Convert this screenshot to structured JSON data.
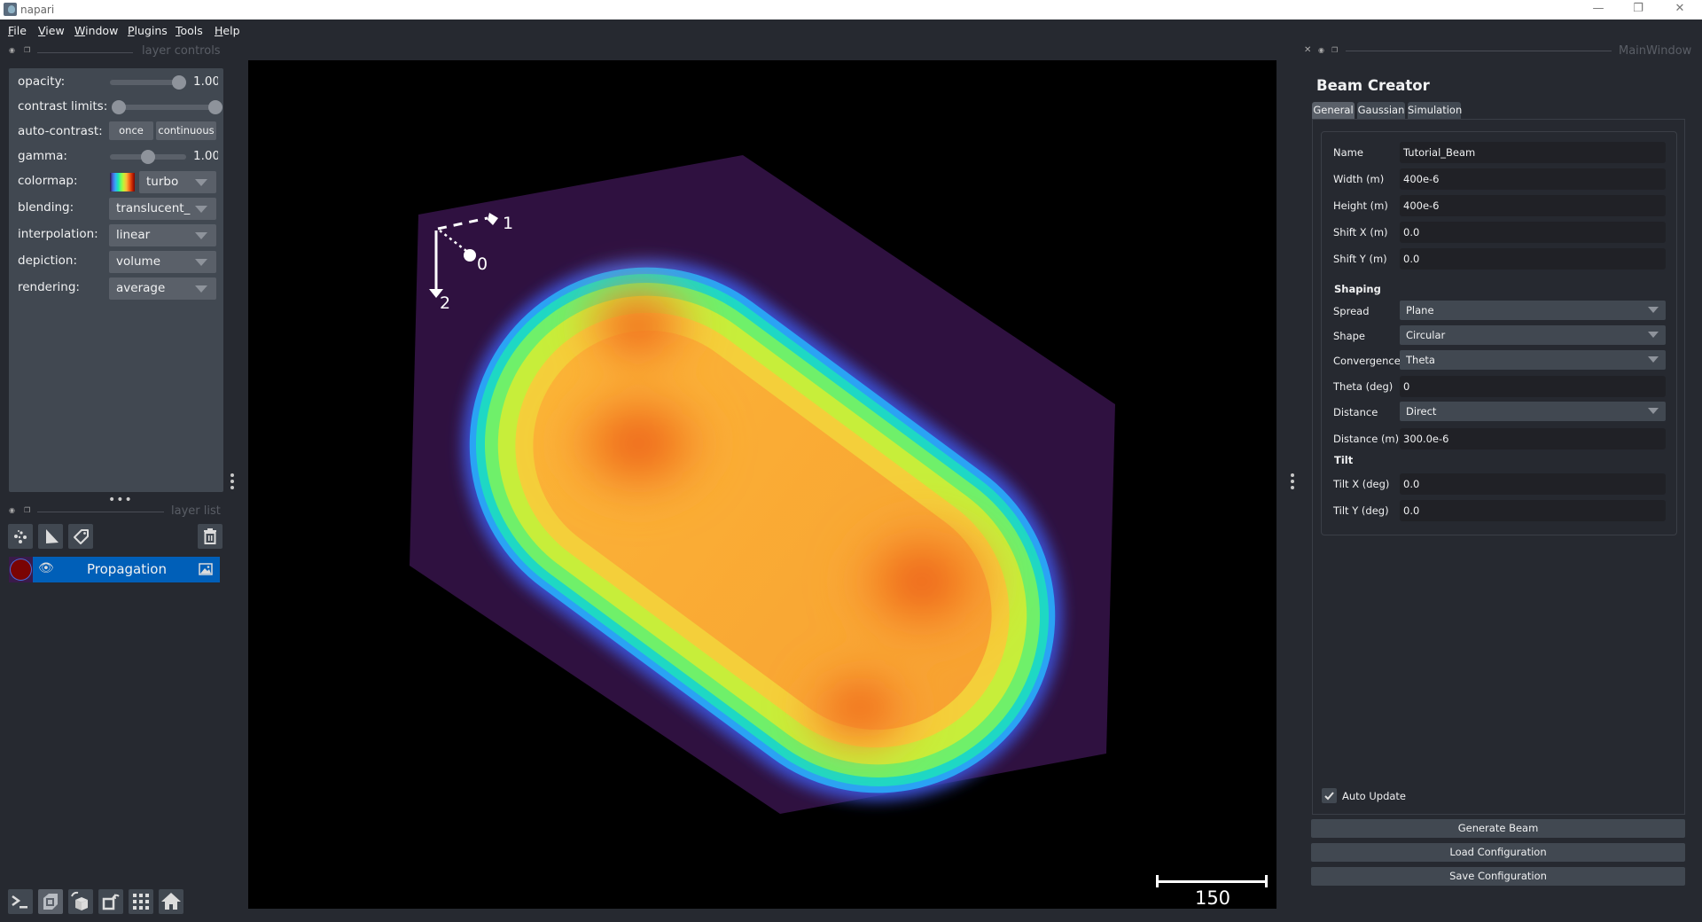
{
  "window": {
    "title": "napari",
    "controls": {
      "minimize": "—",
      "restore": "❐",
      "close": "✕"
    }
  },
  "menubar": {
    "items": [
      {
        "label": "File",
        "mnemonic": "F",
        "rest": "ile"
      },
      {
        "label": "View",
        "mnemonic": "V",
        "rest": "iew"
      },
      {
        "label": "Window",
        "mnemonic": "W",
        "rest": "indow"
      },
      {
        "label": "Plugins",
        "mnemonic": "P",
        "rest": "lugins"
      },
      {
        "label": "Tools",
        "mnemonic": "T",
        "rest": "ools"
      },
      {
        "label": "Help",
        "mnemonic": "H",
        "rest": "elp"
      }
    ]
  },
  "layer_controls": {
    "dock_title": "layer controls",
    "opacity": {
      "label": "opacity:",
      "value": "1.00",
      "fraction": 1.0
    },
    "contrast_limits": {
      "label": "contrast limits:",
      "low_fraction": 0.0,
      "high_fraction": 1.0
    },
    "auto_contrast": {
      "label": "auto-contrast:",
      "once": "once",
      "continuous": "continuous"
    },
    "gamma": {
      "label": "gamma:",
      "value": "1.00",
      "fraction": 0.5
    },
    "colormap": {
      "label": "colormap:",
      "value": "turbo"
    },
    "blending": {
      "label": "blending:",
      "value": "translucent_"
    },
    "interpolation": {
      "label": "interpolation:",
      "value": "linear"
    },
    "depiction": {
      "label": "depiction:",
      "value": "volume"
    },
    "rendering": {
      "label": "rendering:",
      "value": "average"
    }
  },
  "layer_list": {
    "dock_title": "layer list",
    "buttons": [
      "new-points",
      "new-shapes",
      "new-labels",
      "delete-layer"
    ],
    "layers": [
      {
        "name": "Propagation",
        "visible": true,
        "type": "image",
        "selected": true
      }
    ]
  },
  "bottom_buttons": [
    "console",
    "toggle-ndisplay",
    "roll-dimensions",
    "transpose-dimensions",
    "grid-mode",
    "reset-view"
  ],
  "canvas": {
    "axes": {
      "labels": [
        "0",
        "1",
        "2"
      ]
    },
    "scale_bar": {
      "value": "150"
    },
    "colors": {
      "volume_bg": "#2f1140",
      "background": "#000000"
    }
  },
  "right_dock": {
    "dock_title": "MainWindow",
    "widget_title": "Beam Creator",
    "tabs": [
      {
        "label": "General",
        "active": true
      },
      {
        "label": "Gaussian",
        "active": false
      },
      {
        "label": "Simulation",
        "active": false
      }
    ],
    "fields": {
      "name": {
        "label": "Name",
        "value": "Tutorial_Beam"
      },
      "width": {
        "label": "Width (m)",
        "value": "400e-6"
      },
      "height": {
        "label": "Height (m)",
        "value": "400e-6"
      },
      "shift_x": {
        "label": "Shift X (m)",
        "value": "0.0"
      },
      "shift_y": {
        "label": "Shift Y (m)",
        "value": "0.0"
      }
    },
    "shaping": {
      "title": "Shaping",
      "spread": {
        "label": "Spread",
        "value": "Plane"
      },
      "shape": {
        "label": "Shape",
        "value": "Circular"
      },
      "convergence": {
        "label": "Convergence",
        "value": "Theta"
      },
      "theta": {
        "label": "Theta (deg)",
        "value": "0"
      },
      "distance_mode": {
        "label": "Distance",
        "value": "Direct"
      },
      "distance": {
        "label": "Distance (m)",
        "value": "300.0e-6"
      }
    },
    "tilt": {
      "title": "Tilt",
      "tilt_x": {
        "label": "Tilt X (deg)",
        "value": "0.0"
      },
      "tilt_y": {
        "label": "Tilt Y (deg)",
        "value": "0.0"
      }
    },
    "auto_update": {
      "label": "Auto Update",
      "checked": true
    },
    "buttons": {
      "generate": "Generate Beam",
      "load": "Load Configuration",
      "save": "Save Configuration"
    }
  }
}
